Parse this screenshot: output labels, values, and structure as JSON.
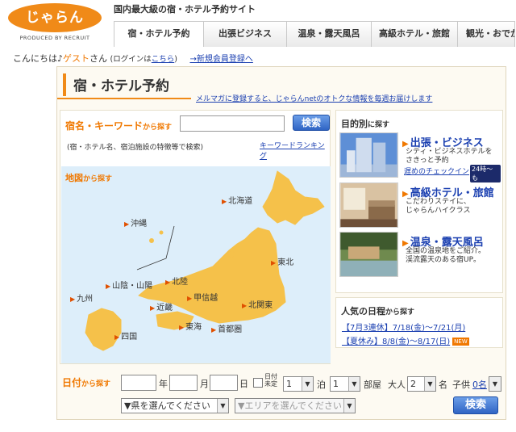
{
  "header": {
    "logo_text": "じゃらん",
    "logo_sub": "PRODUCED BY RECRUIT",
    "tagline": "国内最大級の宿・ホテル予約サイト",
    "tabs": [
      {
        "label": "宿・ホテル予約"
      },
      {
        "label": "出張ビジネス"
      },
      {
        "label": "温泉・露天風呂"
      },
      {
        "label": "高級ホテル・旅館"
      },
      {
        "label": "観光・おでかけ"
      }
    ]
  },
  "greeting": {
    "prefix": "こんにちは♪",
    "guest": "ゲスト",
    "suffix": "さん",
    "login_pre": "(ログインは",
    "login_link": "こちら",
    "login_post": ")",
    "register_link": "→新規会員登録へ"
  },
  "panel": {
    "title": "宿・ホテル予約",
    "promo": "メルマガに登録すると、じゃらんnetのオトクな情報を毎週お届けします"
  },
  "keyword": {
    "label": "宿名・キーワード",
    "label_suffix": "から探す",
    "value": "",
    "button": "検索",
    "note": "(宿・ホテル名、宿泊施設の特徴等で検索)",
    "ranking_link": "キーワードランキング"
  },
  "map": {
    "label": "地図",
    "label_suffix": "から探す",
    "regions": {
      "okinawa": "沖縄",
      "hokkaido": "北海道",
      "tohoku": "東北",
      "sanin_sanyo": "山陰・山陽",
      "hokuriku": "北陸",
      "kyushu": "九州",
      "kinki": "近畿",
      "koshinetsu": "甲信越",
      "kitakanto": "北関東",
      "shikoku": "四国",
      "tokai": "東海",
      "shutoken": "首都圏"
    }
  },
  "purpose": {
    "title": "目的別",
    "title_suffix": "に探す",
    "items": [
      {
        "title": "出張・ビジネス",
        "desc1": "シティ・ビジネスホテルを",
        "desc2": "さきっと予約",
        "link": "遅めのチェックイン",
        "badge": "24時～も"
      },
      {
        "title": "高級ホテル・旅館",
        "desc1": "こだわりステイに、",
        "desc2": "じゃらんハイクラス"
      },
      {
        "title": "温泉・露天風呂",
        "desc1": "全国の温泉地をご紹介。",
        "desc2": "渓流露天のある宿UP。"
      }
    ]
  },
  "popular": {
    "title": "人気の日程",
    "title_suffix": "から探す",
    "links": [
      "【7月3連休】7/18(金)～7/21(月)",
      "【夏休み】8/8(金)～8/17(日)"
    ],
    "new_badge": "NEW"
  },
  "date_search": {
    "label": "日付",
    "label_suffix": "から探す",
    "year_unit": "年",
    "month_unit": "月",
    "day_unit": "日",
    "undecided": "日付未定",
    "nights_value": "1",
    "nights_unit": "泊",
    "rooms_value": "1",
    "rooms_unit": "部屋",
    "adults_label": "大人",
    "adults_value": "2",
    "adults_unit": "名",
    "children_label": "子供",
    "children_link": "0名",
    "pref_placeholder": "▼県を選んでください",
    "area_placeholder": "▼エリアを選んでください",
    "button": "検索"
  }
}
